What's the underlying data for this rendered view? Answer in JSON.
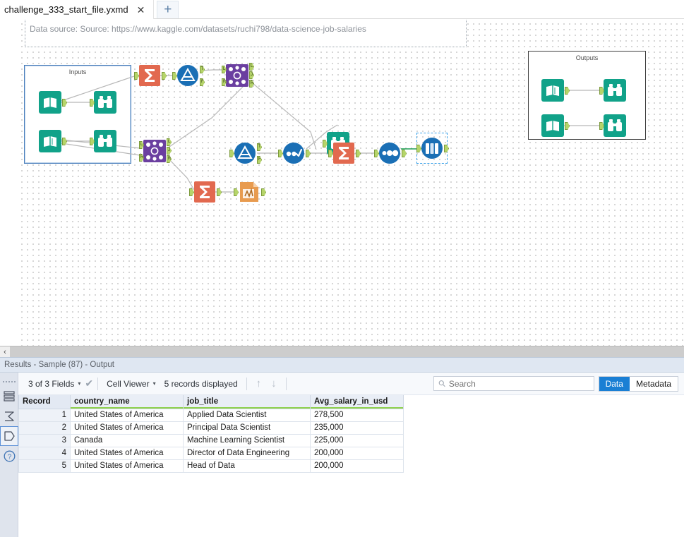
{
  "window": {
    "tab_label": "challenge_333_start_file.yxmd",
    "tab_close": "✕",
    "new_tab": "+"
  },
  "canvas": {
    "comment_text": "Data source: Source: https://www.kaggle.com/datasets/ruchi798/data-science-job-salaries",
    "containers": [
      {
        "title": "Inputs"
      },
      {
        "title": "Outputs"
      }
    ],
    "tools": [
      {
        "name": "input-data-tool-1",
        "type": "input-data-icon"
      },
      {
        "name": "input-data-tool-2",
        "type": "input-data-icon"
      },
      {
        "name": "browse-tool-1",
        "type": "browse-icon"
      },
      {
        "name": "browse-tool-2",
        "type": "browse-icon"
      },
      {
        "name": "summarize-tool-1",
        "type": "summarize-icon"
      },
      {
        "name": "filter-tool-1",
        "type": "filter-icon"
      },
      {
        "name": "join-tool-1",
        "type": "join-icon"
      },
      {
        "name": "join-tool-2",
        "type": "join-icon"
      },
      {
        "name": "filter-tool-2",
        "type": "filter-icon"
      },
      {
        "name": "sort-tool-1",
        "type": "sort-icon"
      },
      {
        "name": "summarize-tool-2",
        "type": "summarize-icon"
      },
      {
        "name": "sample-tool-1",
        "type": "sample-icon"
      },
      {
        "name": "select-tool-1",
        "type": "select-icon"
      },
      {
        "name": "browse-tool-3",
        "type": "browse-icon"
      },
      {
        "name": "summarize-tool-3",
        "type": "summarize-icon"
      },
      {
        "name": "running-total-tool-1",
        "type": "running-total-icon"
      },
      {
        "name": "output-data-tool-1",
        "type": "input-data-icon"
      },
      {
        "name": "output-data-tool-2",
        "type": "input-data-icon"
      },
      {
        "name": "browse-tool-4",
        "type": "browse-icon"
      },
      {
        "name": "browse-tool-5",
        "type": "browse-icon"
      }
    ],
    "anchor_labels": {
      "left": "L",
      "right": "R",
      "join": "J",
      "true": "T",
      "false": "F"
    },
    "colors": {
      "summarize": "#e2694f",
      "filter": "#1a6fb5",
      "join": "#6b3fa0",
      "sort": "#1a6fb5",
      "sample": "#1a6fb5",
      "select": "#1a6fb5",
      "browse": "#11a289",
      "input": "#11a289",
      "running_total": "#e89b4f",
      "anchor": "#b5d46a",
      "selection": "#37a0e8",
      "wire": "#b8b8b8"
    }
  },
  "splitter": {
    "collapse_arrow": "‹"
  },
  "results": {
    "title": "Results - Sample (87) - Output",
    "sidebar_icons": [
      {
        "name": "data-layers-icon",
        "glyph": "layers"
      },
      {
        "name": "sigma-icon",
        "glyph": "sigma"
      },
      {
        "name": "tag-icon",
        "glyph": "tag",
        "active": true
      },
      {
        "name": "help-icon",
        "glyph": "question"
      }
    ],
    "toolbar": {
      "fields_label": "3 of 3 Fields",
      "fields_caret": "▾",
      "check_glyph": "✔",
      "cell_viewer_label": "Cell Viewer",
      "cell_viewer_caret": "▾",
      "records_label": "5 records displayed",
      "up_arrow": "↑",
      "down_arrow": "↓",
      "search_placeholder": "Search",
      "search_value": "",
      "data_button": "Data",
      "metadata_button": "Metadata"
    },
    "table": {
      "columns": [
        "Record",
        "country_name",
        "job_title",
        "Avg_salary_in_usd"
      ],
      "rows": [
        {
          "record": "1",
          "country_name": "United States of America",
          "job_title": "Applied Data Scientist",
          "avg_salary_in_usd": "278,500"
        },
        {
          "record": "2",
          "country_name": "United States of America",
          "job_title": "Principal Data Scientist",
          "avg_salary_in_usd": "235,000"
        },
        {
          "record": "3",
          "country_name": "Canada",
          "job_title": "Machine Learning Scientist",
          "avg_salary_in_usd": "225,000"
        },
        {
          "record": "4",
          "country_name": "United States of America",
          "job_title": "Director of Data Engineering",
          "avg_salary_in_usd": "200,000"
        },
        {
          "record": "5",
          "country_name": "United States of America",
          "job_title": "Head of Data",
          "avg_salary_in_usd": "200,000"
        }
      ]
    }
  }
}
